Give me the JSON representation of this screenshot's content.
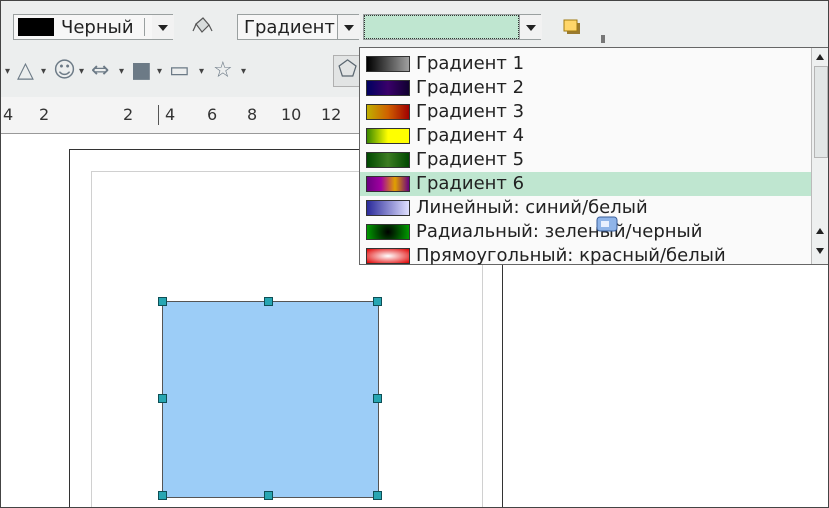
{
  "toolbar": {
    "line_color": {
      "label": "Черный",
      "swatch": "#000000"
    },
    "area_style_icon": "paint-bucket-icon",
    "area_style": {
      "label": "Градиент"
    },
    "area_fill": {
      "value": "",
      "color": "#bfe6d0"
    },
    "shadow_icon": "shadow-icon"
  },
  "shapes_toolbar": {
    "tools": [
      {
        "name": "basic-shapes-icon",
        "glyph": "△"
      },
      {
        "name": "symbol-shapes-icon",
        "glyph": "☺"
      },
      {
        "name": "block-arrows-icon",
        "glyph": "⇔"
      },
      {
        "name": "flowchart-icon",
        "glyph": "■"
      },
      {
        "name": "callouts-icon",
        "glyph": "▭"
      },
      {
        "name": "stars-icon",
        "glyph": "☆"
      },
      {
        "name": "points-icon",
        "glyph": "⬠"
      }
    ]
  },
  "ruler": {
    "ticks": [
      "4",
      "2",
      "2",
      "4",
      "6",
      "8",
      "10",
      "12"
    ]
  },
  "gradient_list": {
    "items": [
      {
        "label": "Градиент 1",
        "gradient": "linear-gradient(to right,#000000,#a0a0a0)"
      },
      {
        "label": "Градиент 2",
        "gradient": "linear-gradient(to right,#000060,#3a006a,#100030)"
      },
      {
        "label": "Градиент 3",
        "gradient": "linear-gradient(to right,#c0b000,#d06000,#a00000)"
      },
      {
        "label": "Градиент 4",
        "gradient": "linear-gradient(to right,#3a8800,#ffff00,#ffff00)"
      },
      {
        "label": "Градиент 5",
        "gradient": "linear-gradient(to right,#004800,#3c7c22,#004800)"
      },
      {
        "label": "Градиент 6",
        "gradient": "linear-gradient(to right,#6a0080,#a000a0,#e0a000,#6a0080)",
        "selected": true
      },
      {
        "label": "Линейный: синий/белый",
        "gradient": "linear-gradient(to right,#2a2a9a,#e0e0ff)"
      },
      {
        "label": "Радиальный: зеленый/черный",
        "gradient": "radial-gradient(circle,#000000,#00a000)"
      },
      {
        "label": "Прямоугольный: красный/белый",
        "gradient": "radial-gradient(ellipse,#ffffff,#e00000)"
      }
    ]
  },
  "shape": {
    "fill": "#9ccdf7"
  }
}
